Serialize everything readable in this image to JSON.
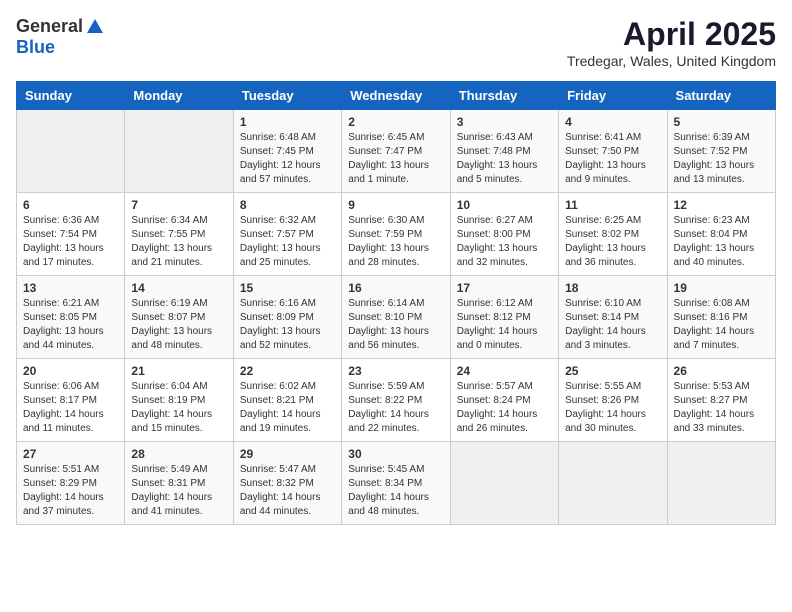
{
  "header": {
    "logo_general": "General",
    "logo_blue": "Blue",
    "title": "April 2025",
    "location": "Tredegar, Wales, United Kingdom"
  },
  "calendar": {
    "weekdays": [
      "Sunday",
      "Monday",
      "Tuesday",
      "Wednesday",
      "Thursday",
      "Friday",
      "Saturday"
    ],
    "weeks": [
      [
        {
          "day": "",
          "info": ""
        },
        {
          "day": "",
          "info": ""
        },
        {
          "day": "1",
          "info": "Sunrise: 6:48 AM\nSunset: 7:45 PM\nDaylight: 12 hours\nand 57 minutes."
        },
        {
          "day": "2",
          "info": "Sunrise: 6:45 AM\nSunset: 7:47 PM\nDaylight: 13 hours\nand 1 minute."
        },
        {
          "day": "3",
          "info": "Sunrise: 6:43 AM\nSunset: 7:48 PM\nDaylight: 13 hours\nand 5 minutes."
        },
        {
          "day": "4",
          "info": "Sunrise: 6:41 AM\nSunset: 7:50 PM\nDaylight: 13 hours\nand 9 minutes."
        },
        {
          "day": "5",
          "info": "Sunrise: 6:39 AM\nSunset: 7:52 PM\nDaylight: 13 hours\nand 13 minutes."
        }
      ],
      [
        {
          "day": "6",
          "info": "Sunrise: 6:36 AM\nSunset: 7:54 PM\nDaylight: 13 hours\nand 17 minutes."
        },
        {
          "day": "7",
          "info": "Sunrise: 6:34 AM\nSunset: 7:55 PM\nDaylight: 13 hours\nand 21 minutes."
        },
        {
          "day": "8",
          "info": "Sunrise: 6:32 AM\nSunset: 7:57 PM\nDaylight: 13 hours\nand 25 minutes."
        },
        {
          "day": "9",
          "info": "Sunrise: 6:30 AM\nSunset: 7:59 PM\nDaylight: 13 hours\nand 28 minutes."
        },
        {
          "day": "10",
          "info": "Sunrise: 6:27 AM\nSunset: 8:00 PM\nDaylight: 13 hours\nand 32 minutes."
        },
        {
          "day": "11",
          "info": "Sunrise: 6:25 AM\nSunset: 8:02 PM\nDaylight: 13 hours\nand 36 minutes."
        },
        {
          "day": "12",
          "info": "Sunrise: 6:23 AM\nSunset: 8:04 PM\nDaylight: 13 hours\nand 40 minutes."
        }
      ],
      [
        {
          "day": "13",
          "info": "Sunrise: 6:21 AM\nSunset: 8:05 PM\nDaylight: 13 hours\nand 44 minutes."
        },
        {
          "day": "14",
          "info": "Sunrise: 6:19 AM\nSunset: 8:07 PM\nDaylight: 13 hours\nand 48 minutes."
        },
        {
          "day": "15",
          "info": "Sunrise: 6:16 AM\nSunset: 8:09 PM\nDaylight: 13 hours\nand 52 minutes."
        },
        {
          "day": "16",
          "info": "Sunrise: 6:14 AM\nSunset: 8:10 PM\nDaylight: 13 hours\nand 56 minutes."
        },
        {
          "day": "17",
          "info": "Sunrise: 6:12 AM\nSunset: 8:12 PM\nDaylight: 14 hours\nand 0 minutes."
        },
        {
          "day": "18",
          "info": "Sunrise: 6:10 AM\nSunset: 8:14 PM\nDaylight: 14 hours\nand 3 minutes."
        },
        {
          "day": "19",
          "info": "Sunrise: 6:08 AM\nSunset: 8:16 PM\nDaylight: 14 hours\nand 7 minutes."
        }
      ],
      [
        {
          "day": "20",
          "info": "Sunrise: 6:06 AM\nSunset: 8:17 PM\nDaylight: 14 hours\nand 11 minutes."
        },
        {
          "day": "21",
          "info": "Sunrise: 6:04 AM\nSunset: 8:19 PM\nDaylight: 14 hours\nand 15 minutes."
        },
        {
          "day": "22",
          "info": "Sunrise: 6:02 AM\nSunset: 8:21 PM\nDaylight: 14 hours\nand 19 minutes."
        },
        {
          "day": "23",
          "info": "Sunrise: 5:59 AM\nSunset: 8:22 PM\nDaylight: 14 hours\nand 22 minutes."
        },
        {
          "day": "24",
          "info": "Sunrise: 5:57 AM\nSunset: 8:24 PM\nDaylight: 14 hours\nand 26 minutes."
        },
        {
          "day": "25",
          "info": "Sunrise: 5:55 AM\nSunset: 8:26 PM\nDaylight: 14 hours\nand 30 minutes."
        },
        {
          "day": "26",
          "info": "Sunrise: 5:53 AM\nSunset: 8:27 PM\nDaylight: 14 hours\nand 33 minutes."
        }
      ],
      [
        {
          "day": "27",
          "info": "Sunrise: 5:51 AM\nSunset: 8:29 PM\nDaylight: 14 hours\nand 37 minutes."
        },
        {
          "day": "28",
          "info": "Sunrise: 5:49 AM\nSunset: 8:31 PM\nDaylight: 14 hours\nand 41 minutes."
        },
        {
          "day": "29",
          "info": "Sunrise: 5:47 AM\nSunset: 8:32 PM\nDaylight: 14 hours\nand 44 minutes."
        },
        {
          "day": "30",
          "info": "Sunrise: 5:45 AM\nSunset: 8:34 PM\nDaylight: 14 hours\nand 48 minutes."
        },
        {
          "day": "",
          "info": ""
        },
        {
          "day": "",
          "info": ""
        },
        {
          "day": "",
          "info": ""
        }
      ]
    ]
  }
}
